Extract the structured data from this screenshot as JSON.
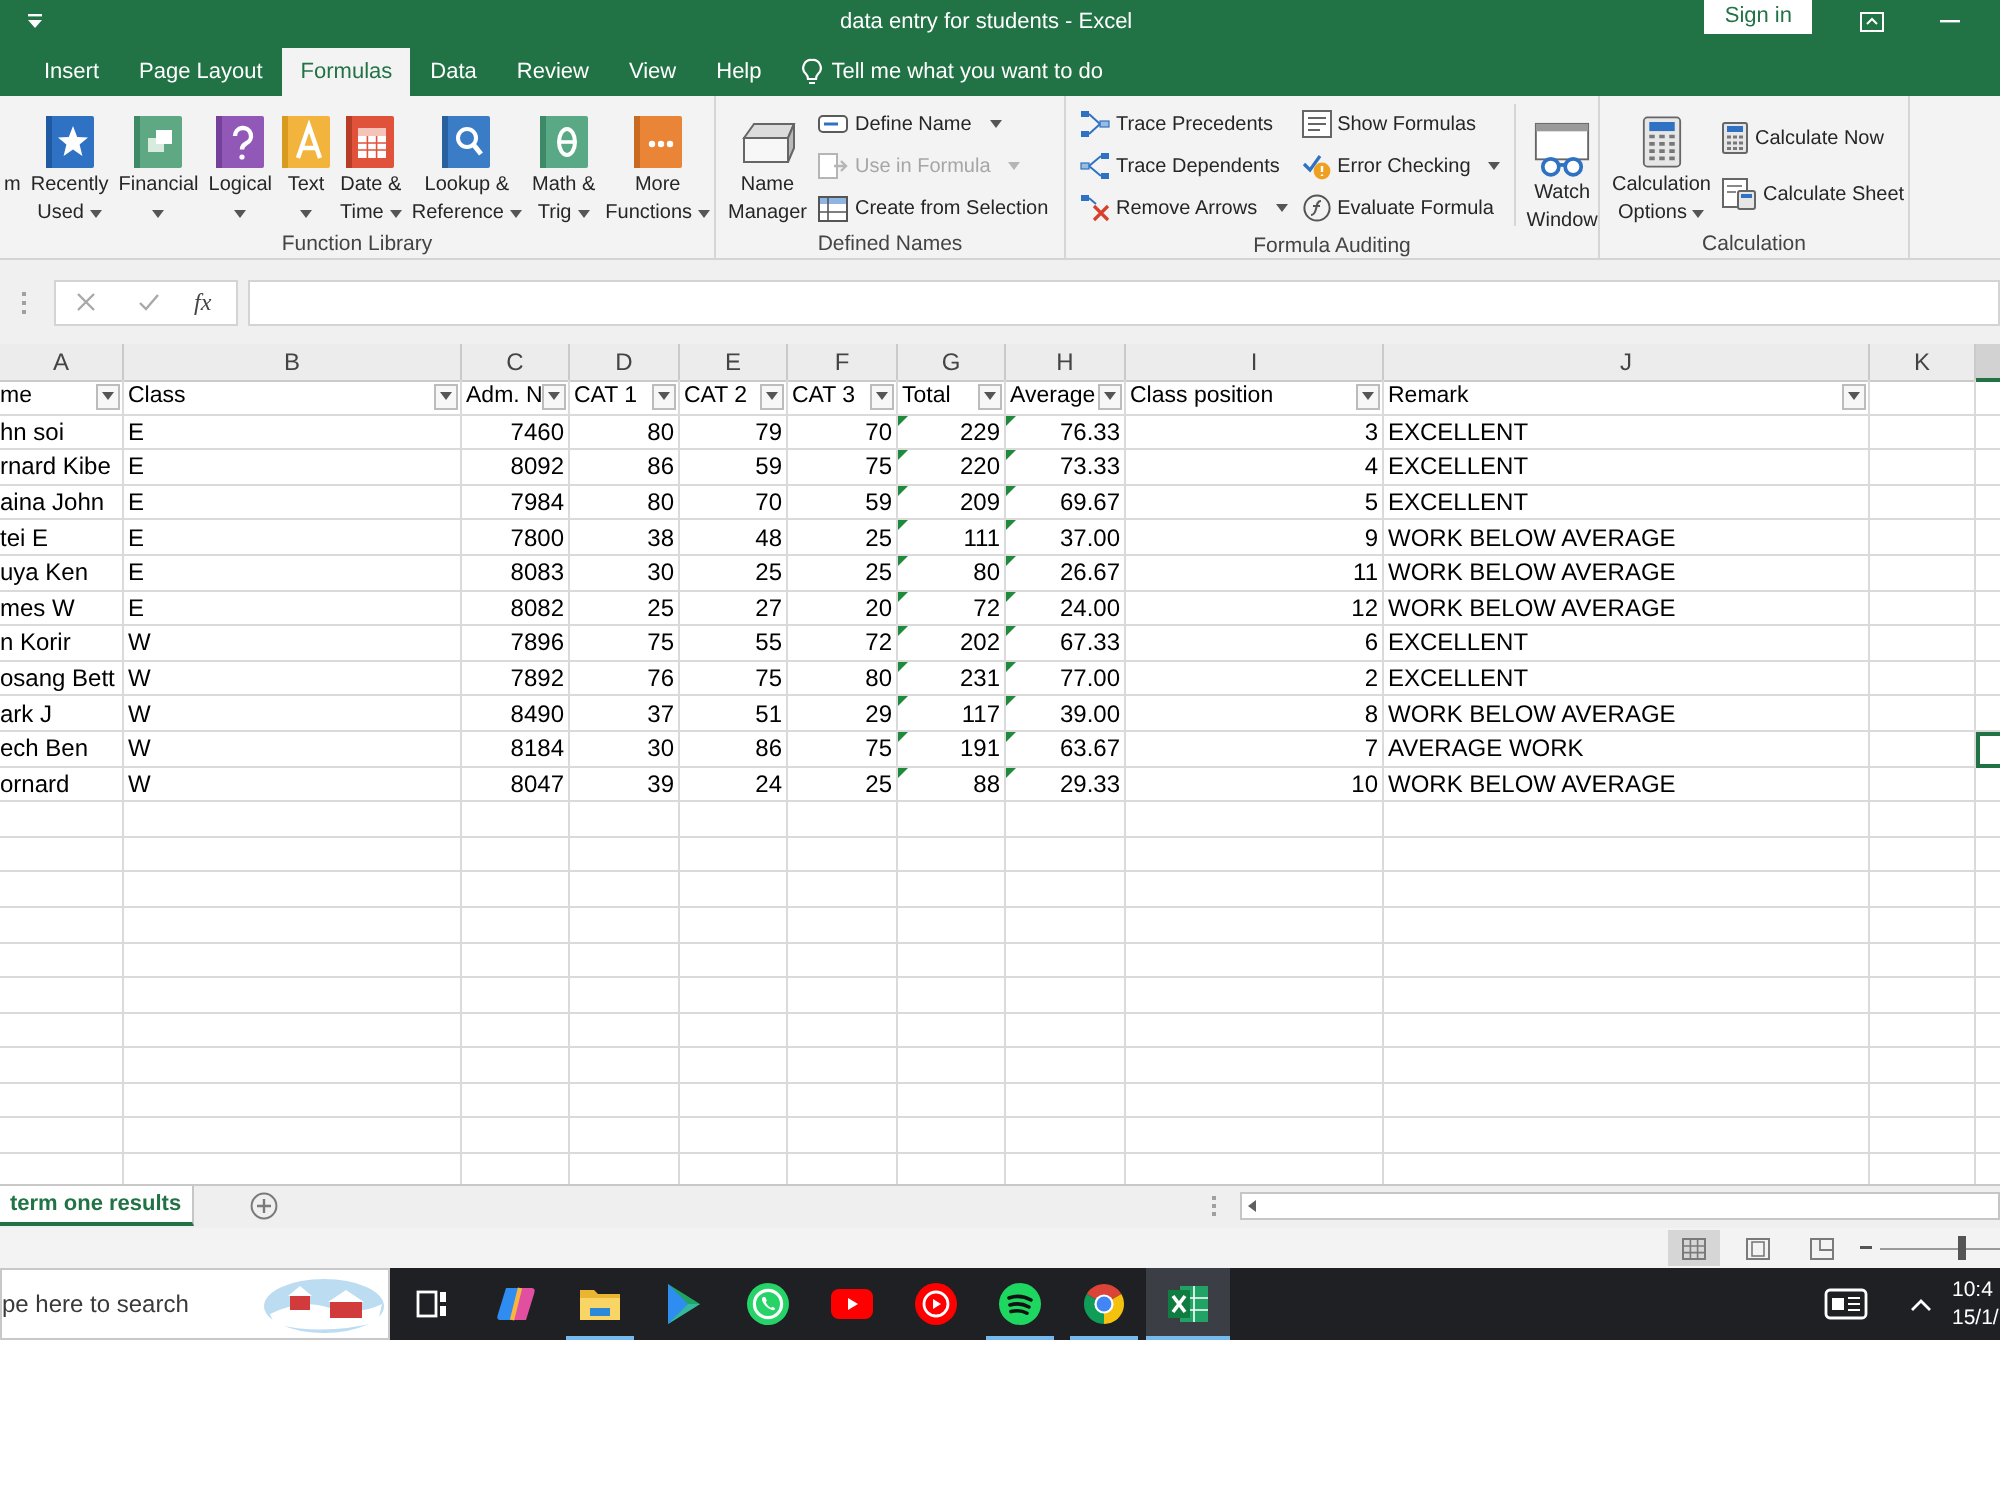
{
  "title_bar": {
    "title": "data entry for students - Excel",
    "sign_in": "Sign in"
  },
  "tabs": [
    {
      "label": "Insert",
      "selected": false
    },
    {
      "label": "Page Layout",
      "selected": false
    },
    {
      "label": "Formulas",
      "selected": true
    },
    {
      "label": "Data",
      "selected": false
    },
    {
      "label": "Review",
      "selected": false
    },
    {
      "label": "View",
      "selected": false
    },
    {
      "label": "Help",
      "selected": false
    }
  ],
  "tell_me": "Tell me what you want to do",
  "ribbon_groups": [
    {
      "label": "Function Library",
      "items": [
        {
          "kind": "large",
          "lines": [
            "m"
          ],
          "dropdown": false,
          "disabled": false
        },
        {
          "kind": "large",
          "lines": [
            "Recently",
            "Used"
          ],
          "dropdown": true,
          "disabled": false
        },
        {
          "kind": "large",
          "lines": [
            "Financial"
          ],
          "dropdown": true,
          "disabled": false
        },
        {
          "kind": "large",
          "lines": [
            "Logical"
          ],
          "dropdown": true,
          "disabled": false
        },
        {
          "kind": "large",
          "lines": [
            "Text"
          ],
          "dropdown": true,
          "disabled": false
        },
        {
          "kind": "large",
          "lines": [
            "Date &",
            "Time"
          ],
          "dropdown": true,
          "disabled": false
        },
        {
          "kind": "large",
          "lines": [
            "Lookup &",
            "Reference"
          ],
          "dropdown": true,
          "disabled": false
        },
        {
          "kind": "large",
          "lines": [
            "Math &",
            "Trig"
          ],
          "dropdown": true,
          "disabled": false
        },
        {
          "kind": "large",
          "lines": [
            "More",
            "Functions"
          ],
          "dropdown": true,
          "disabled": false
        }
      ]
    },
    {
      "label": "Defined Names",
      "items": [
        {
          "kind": "large",
          "lines": [
            "Name",
            "Manager"
          ],
          "dropdown": false,
          "disabled": false
        },
        {
          "kind": "small",
          "label": "Define Name",
          "dropdown": true,
          "disabled": false
        },
        {
          "kind": "small",
          "label": "Use in Formula",
          "dropdown": true,
          "disabled": true
        },
        {
          "kind": "small",
          "label": "Create from Selection",
          "dropdown": false,
          "disabled": false
        }
      ]
    },
    {
      "label": "Formula Auditing",
      "items": [
        {
          "kind": "small",
          "label": "Trace Precedents",
          "dropdown": false,
          "disabled": false
        },
        {
          "kind": "small",
          "label": "Trace Dependents",
          "dropdown": false,
          "disabled": false
        },
        {
          "kind": "small",
          "label": "Remove Arrows",
          "dropdown": true,
          "disabled": false
        },
        {
          "kind": "small",
          "label": "Show Formulas",
          "dropdown": false,
          "disabled": false
        },
        {
          "kind": "small",
          "label": "Error Checking",
          "dropdown": true,
          "disabled": false
        },
        {
          "kind": "small",
          "label": "Evaluate Formula",
          "dropdown": false,
          "disabled": false
        },
        {
          "kind": "large",
          "lines": [
            "Watch",
            "Window"
          ],
          "dropdown": false,
          "disabled": false
        }
      ]
    },
    {
      "label": "Calculation",
      "items": [
        {
          "kind": "large",
          "lines": [
            "Calculation",
            "Options"
          ],
          "dropdown": true,
          "disabled": false
        },
        {
          "kind": "small",
          "label": "Calculate Now",
          "dropdown": false,
          "disabled": false
        },
        {
          "kind": "small",
          "label": "Calculate Sheet",
          "dropdown": false,
          "disabled": false
        }
      ]
    }
  ],
  "formula_bar": {
    "function_symbol": "fx"
  },
  "spreadsheet": {
    "column_letters": [
      "A",
      "B",
      "C",
      "D",
      "E",
      "F",
      "G",
      "H",
      "I",
      "J",
      "K"
    ],
    "columns": [
      {
        "label": "me",
        "kind": "text",
        "error_marker": false
      },
      {
        "label": "Class",
        "kind": "text",
        "error_marker": false
      },
      {
        "label": "Adm. N",
        "kind": "number",
        "error_marker": false
      },
      {
        "label": "CAT 1",
        "kind": "number",
        "error_marker": false
      },
      {
        "label": "CAT 2",
        "kind": "number",
        "error_marker": false
      },
      {
        "label": "CAT 3",
        "kind": "number",
        "error_marker": false
      },
      {
        "label": "Total",
        "kind": "number",
        "error_marker": true
      },
      {
        "label": "Average",
        "kind": "number",
        "error_marker": true
      },
      {
        "label": "Class position",
        "kind": "number",
        "error_marker": false
      },
      {
        "label": "Remark",
        "kind": "text",
        "error_marker": false
      }
    ],
    "rows": [
      {
        "cells": [
          "hn soi",
          "E",
          "7460",
          "80",
          "79",
          "70",
          "229",
          "76.33",
          "3",
          "EXCELLENT"
        ],
        "active_cell": false
      },
      {
        "cells": [
          "rnard Kibe",
          "E",
          "8092",
          "86",
          "59",
          "75",
          "220",
          "73.33",
          "4",
          "EXCELLENT"
        ],
        "active_cell": false
      },
      {
        "cells": [
          "aina John",
          "E",
          "7984",
          "80",
          "70",
          "59",
          "209",
          "69.67",
          "5",
          "EXCELLENT"
        ],
        "active_cell": false
      },
      {
        "cells": [
          "tei E",
          "E",
          "7800",
          "38",
          "48",
          "25",
          "111",
          "37.00",
          "9",
          "WORK BELOW AVERAGE"
        ],
        "active_cell": false
      },
      {
        "cells": [
          "uya Ken",
          "E",
          "8083",
          "30",
          "25",
          "25",
          "80",
          "26.67",
          "11",
          "WORK BELOW AVERAGE"
        ],
        "active_cell": false
      },
      {
        "cells": [
          "mes W",
          "E",
          "8082",
          "25",
          "27",
          "20",
          "72",
          "24.00",
          "12",
          "WORK BELOW AVERAGE"
        ],
        "active_cell": false
      },
      {
        "cells": [
          "n Korir",
          "W",
          "7896",
          "75",
          "55",
          "72",
          "202",
          "67.33",
          "6",
          "EXCELLENT"
        ],
        "active_cell": false
      },
      {
        "cells": [
          "osang Bett",
          "W",
          "7892",
          "76",
          "75",
          "80",
          "231",
          "77.00",
          "2",
          "EXCELLENT"
        ],
        "active_cell": false
      },
      {
        "cells": [
          "ark J",
          "W",
          "8490",
          "37",
          "51",
          "29",
          "117",
          "39.00",
          "8",
          "WORK BELOW AVERAGE"
        ],
        "active_cell": false
      },
      {
        "cells": [
          "ech Ben",
          "W",
          "8184",
          "30",
          "86",
          "75",
          "191",
          "63.67",
          "7",
          "AVERAGE WORK"
        ],
        "active_cell": true
      },
      {
        "cells": [
          "ornard",
          "W",
          "8047",
          "39",
          "24",
          "25",
          "88",
          "29.33",
          "10",
          "WORK BELOW AVERAGE"
        ],
        "active_cell": false
      }
    ]
  },
  "sheet_tabs": [
    {
      "label": "term one results",
      "selected": true
    }
  ],
  "status_bar": {
    "views": [
      {
        "selected": true
      },
      {
        "selected": false
      },
      {
        "selected": false
      }
    ],
    "zoom": {
      "level": 0.68
    }
  },
  "taskbar": {
    "search_placeholder": "pe here to search",
    "apps": [
      {
        "running": false,
        "active": false
      },
      {
        "running": false,
        "active": false
      },
      {
        "running": true,
        "active": false
      },
      {
        "running": false,
        "active": false
      },
      {
        "running": false,
        "active": false
      },
      {
        "running": false,
        "active": false
      },
      {
        "running": false,
        "active": false
      },
      {
        "running": true,
        "active": false
      },
      {
        "running": true,
        "active": false
      },
      {
        "running": true,
        "active": true
      }
    ],
    "time": "10:4",
    "date": "15/1/"
  }
}
